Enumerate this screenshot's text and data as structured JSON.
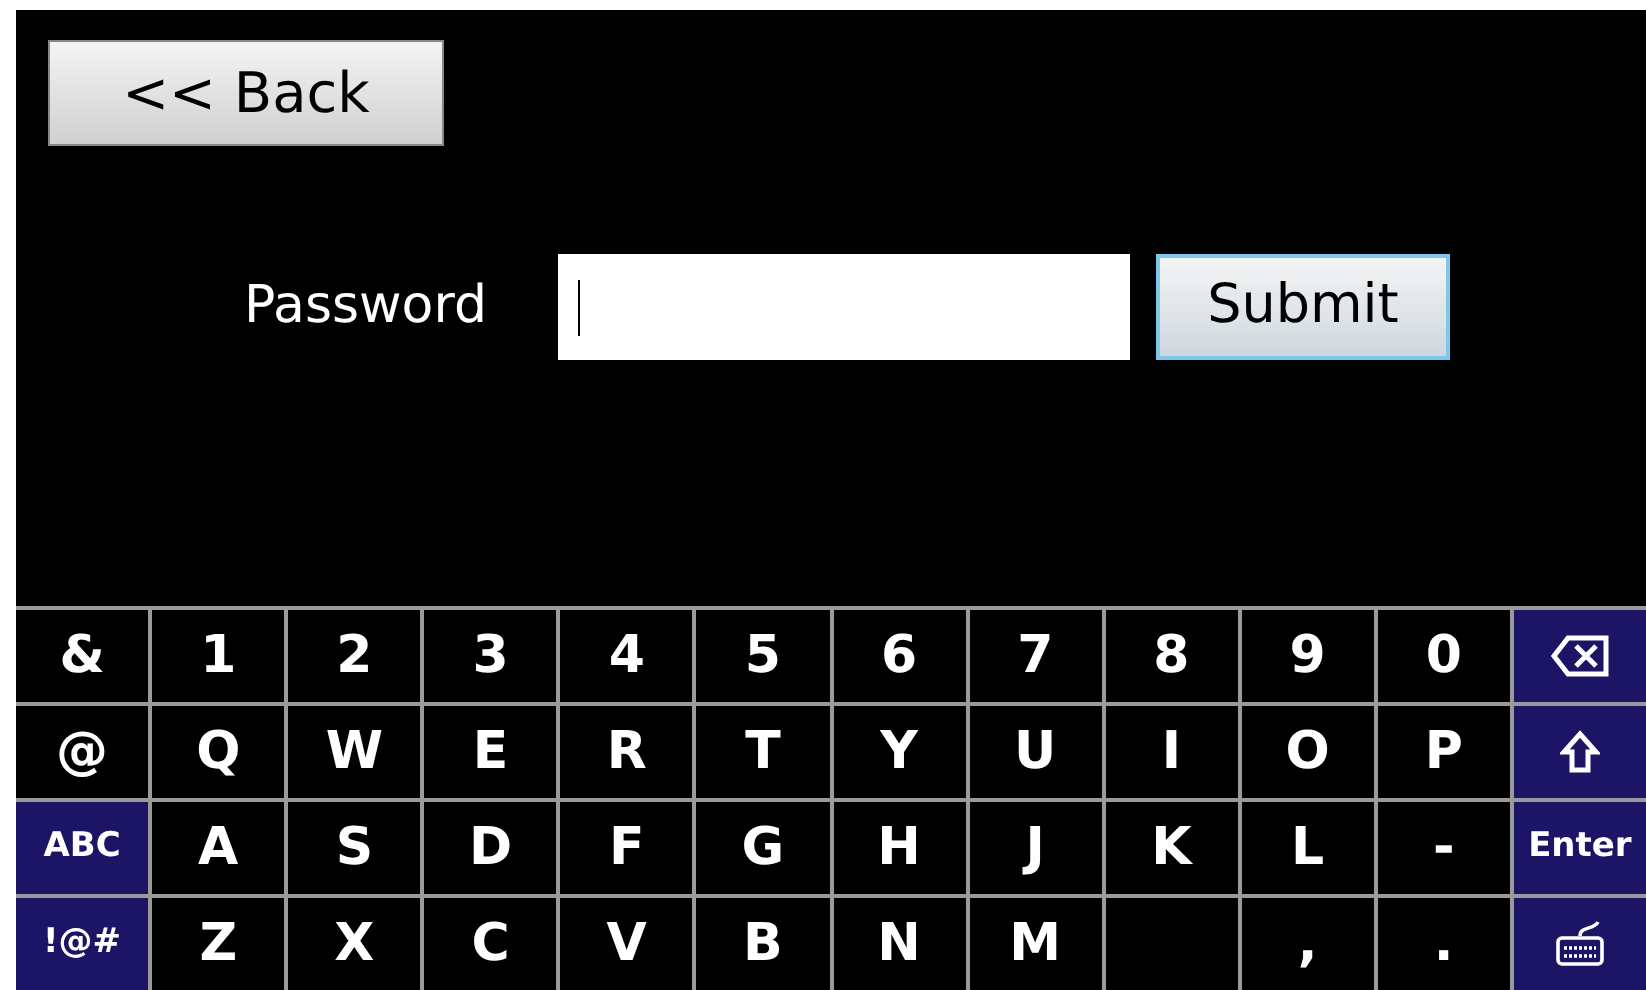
{
  "back_button": {
    "label": "<< Back"
  },
  "password": {
    "label": "Password",
    "focused": true
  },
  "submit_button": {
    "label": "Submit",
    "highlighted": true
  },
  "keyboard": {
    "rows": [
      [
        {
          "kind": "char",
          "label": "&"
        },
        {
          "kind": "char",
          "label": "1"
        },
        {
          "kind": "char",
          "label": "2"
        },
        {
          "kind": "char",
          "label": "3"
        },
        {
          "kind": "char",
          "label": "4"
        },
        {
          "kind": "char",
          "label": "5"
        },
        {
          "kind": "char",
          "label": "6"
        },
        {
          "kind": "char",
          "label": "7"
        },
        {
          "kind": "char",
          "label": "8"
        },
        {
          "kind": "char",
          "label": "9"
        },
        {
          "kind": "char",
          "label": "0"
        },
        {
          "kind": "backspace"
        }
      ],
      [
        {
          "kind": "char",
          "label": "@"
        },
        {
          "kind": "char",
          "label": "Q"
        },
        {
          "kind": "char",
          "label": "W"
        },
        {
          "kind": "char",
          "label": "E"
        },
        {
          "kind": "char",
          "label": "R"
        },
        {
          "kind": "char",
          "label": "T"
        },
        {
          "kind": "char",
          "label": "Y"
        },
        {
          "kind": "char",
          "label": "U"
        },
        {
          "kind": "char",
          "label": "I"
        },
        {
          "kind": "char",
          "label": "O"
        },
        {
          "kind": "char",
          "label": "P"
        },
        {
          "kind": "shift"
        }
      ],
      [
        {
          "kind": "action",
          "label": "ABC"
        },
        {
          "kind": "char",
          "label": "A"
        },
        {
          "kind": "char",
          "label": "S"
        },
        {
          "kind": "char",
          "label": "D"
        },
        {
          "kind": "char",
          "label": "F"
        },
        {
          "kind": "char",
          "label": "G"
        },
        {
          "kind": "char",
          "label": "H"
        },
        {
          "kind": "char",
          "label": "J"
        },
        {
          "kind": "char",
          "label": "K"
        },
        {
          "kind": "char",
          "label": "L"
        },
        {
          "kind": "char",
          "label": "-"
        },
        {
          "kind": "action",
          "label": "Enter"
        }
      ],
      [
        {
          "kind": "action",
          "label": "!@#"
        },
        {
          "kind": "char",
          "label": "Z"
        },
        {
          "kind": "char",
          "label": "X"
        },
        {
          "kind": "char",
          "label": "C"
        },
        {
          "kind": "char",
          "label": "V"
        },
        {
          "kind": "char",
          "label": "B"
        },
        {
          "kind": "char",
          "label": "N"
        },
        {
          "kind": "char",
          "label": "M"
        },
        {
          "kind": "space"
        },
        {
          "kind": "char",
          "label": ","
        },
        {
          "kind": "char",
          "label": "."
        },
        {
          "kind": "hide"
        }
      ]
    ]
  }
}
